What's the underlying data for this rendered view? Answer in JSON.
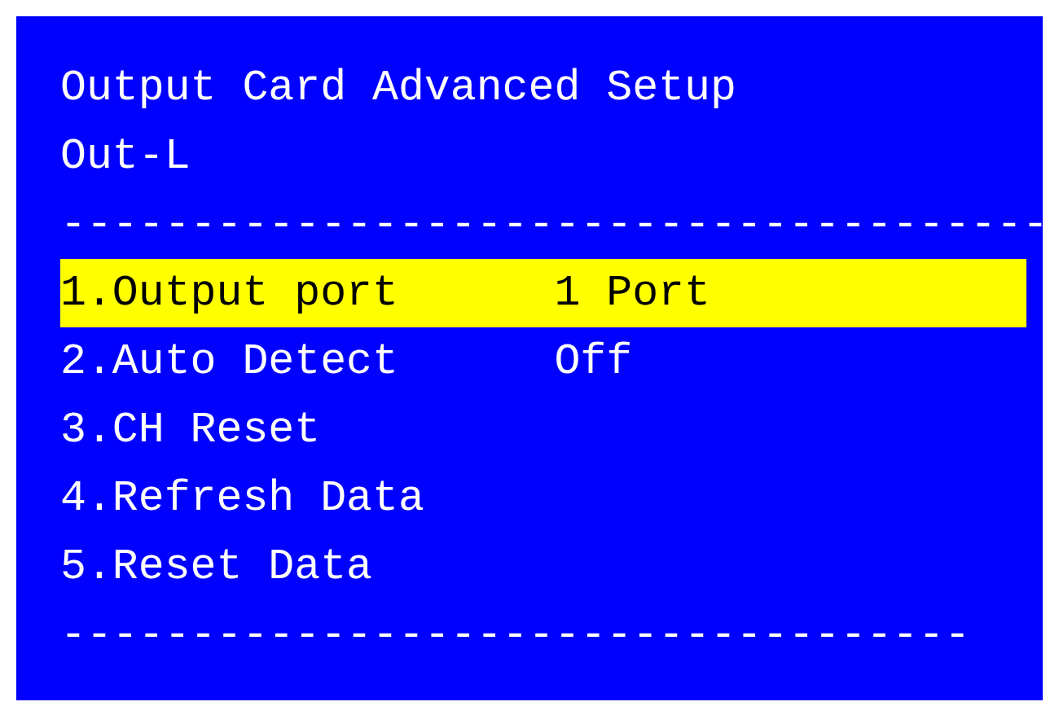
{
  "title": "Output Card Advanced Setup",
  "subtitle": "Out-L",
  "separator_top": "--------------------------------------",
  "items": [
    {
      "label": "1.Output port",
      "value": "1 Port",
      "selected": true
    },
    {
      "label": "2.Auto Detect",
      "value": "Off",
      "selected": false
    },
    {
      "label": "3.CH Reset",
      "selected": false
    },
    {
      "label": "4.Refresh Data",
      "selected": false
    },
    {
      "label": "5.Reset Data",
      "selected": false
    }
  ],
  "separator_bottom": "-----------------------------------"
}
